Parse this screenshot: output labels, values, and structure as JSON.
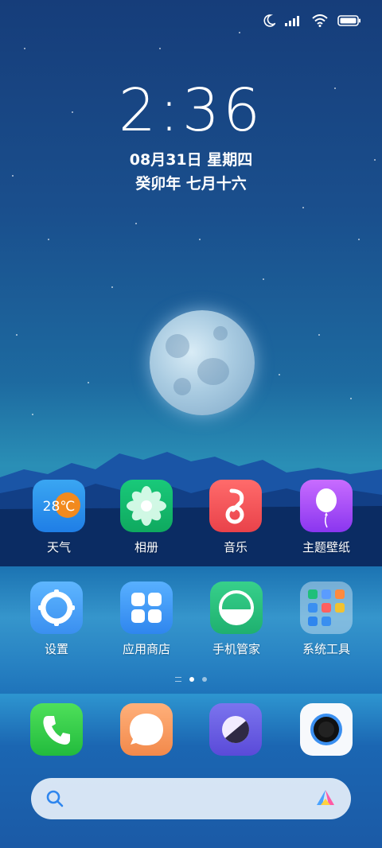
{
  "status_bar": {
    "icons": [
      "moon-icon",
      "signal-icon",
      "wifi-icon",
      "battery-icon"
    ]
  },
  "lockclock": {
    "time": "2:36",
    "date": "08月31日 星期四",
    "lunar": "癸卯年 七月十六"
  },
  "row1": [
    {
      "label": "天气",
      "icon": "weather-icon",
      "temp": "28℃"
    },
    {
      "label": "相册",
      "icon": "gallery-icon"
    },
    {
      "label": "音乐",
      "icon": "music-icon"
    },
    {
      "label": "主题壁纸",
      "icon": "themes-icon"
    }
  ],
  "row2": [
    {
      "label": "设置",
      "icon": "settings-icon"
    },
    {
      "label": "应用商店",
      "icon": "app-store-icon"
    },
    {
      "label": "手机管家",
      "icon": "security-icon"
    },
    {
      "label": "系统工具",
      "icon": "tools-folder-icon"
    }
  ],
  "dock": [
    {
      "icon": "phone-icon"
    },
    {
      "icon": "messages-icon"
    },
    {
      "icon": "browser-icon"
    },
    {
      "icon": "camera-icon"
    }
  ],
  "pager": {
    "pages": 2,
    "active": 1
  },
  "search": {
    "icons": [
      "search-icon",
      "assistant-icon"
    ]
  }
}
